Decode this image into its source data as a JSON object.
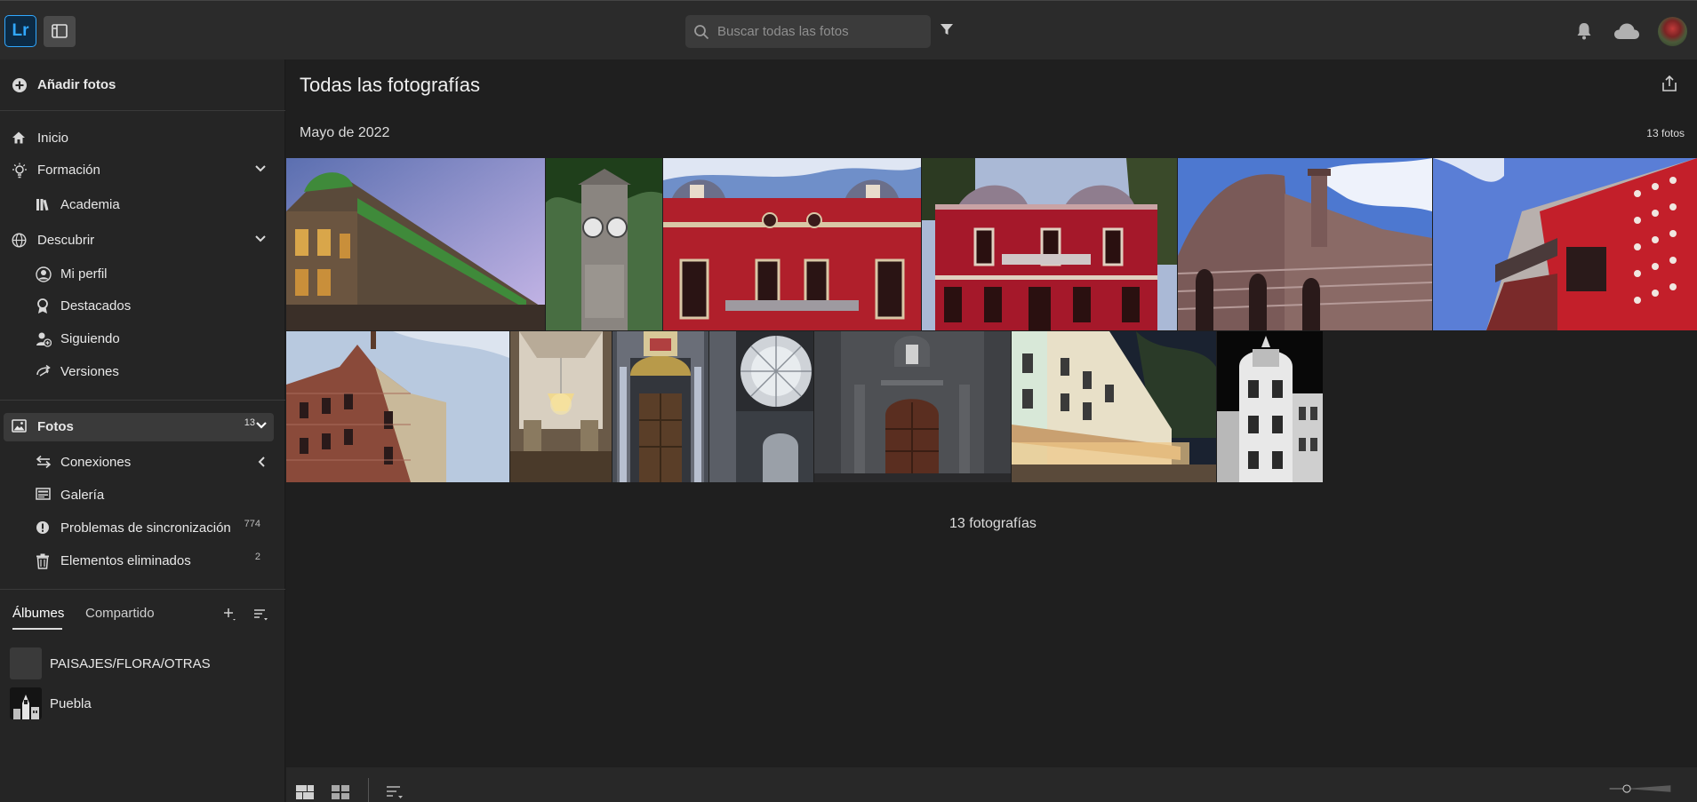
{
  "app": {
    "logo_text": "Lr",
    "accent": "#31a8ff"
  },
  "header": {
    "search_placeholder": "Buscar todas las fotos",
    "icons": [
      "panel-toggle-icon",
      "search-icon",
      "filter-icon",
      "bell-icon",
      "cloud-icon",
      "avatar"
    ]
  },
  "sidebar": {
    "add_photos": "Añadir fotos",
    "home": "Inicio",
    "learn": "Formación",
    "academy": "Academia",
    "discover": "Descubrir",
    "my_profile": "Mi perfil",
    "featured": "Destacados",
    "following": "Siguiendo",
    "versions": "Versiones",
    "photos": "Fotos",
    "photos_count": "13",
    "connections": "Conexiones",
    "gallery": "Galería",
    "sync_problems": "Problemas de sincronización",
    "sync_count": "774",
    "deleted": "Elementos eliminados",
    "deleted_count": "2"
  },
  "albums": {
    "tab_albums": "Álbumes",
    "tab_shared": "Compartido",
    "items": [
      {
        "name": "PAISAJES/FLORA/OTRAS"
      },
      {
        "name": "Puebla"
      }
    ]
  },
  "main": {
    "title": "Todas las fotografías",
    "group_title": "Mayo de 2022",
    "group_count": "13 fotos",
    "summary": "13 fotografías"
  }
}
